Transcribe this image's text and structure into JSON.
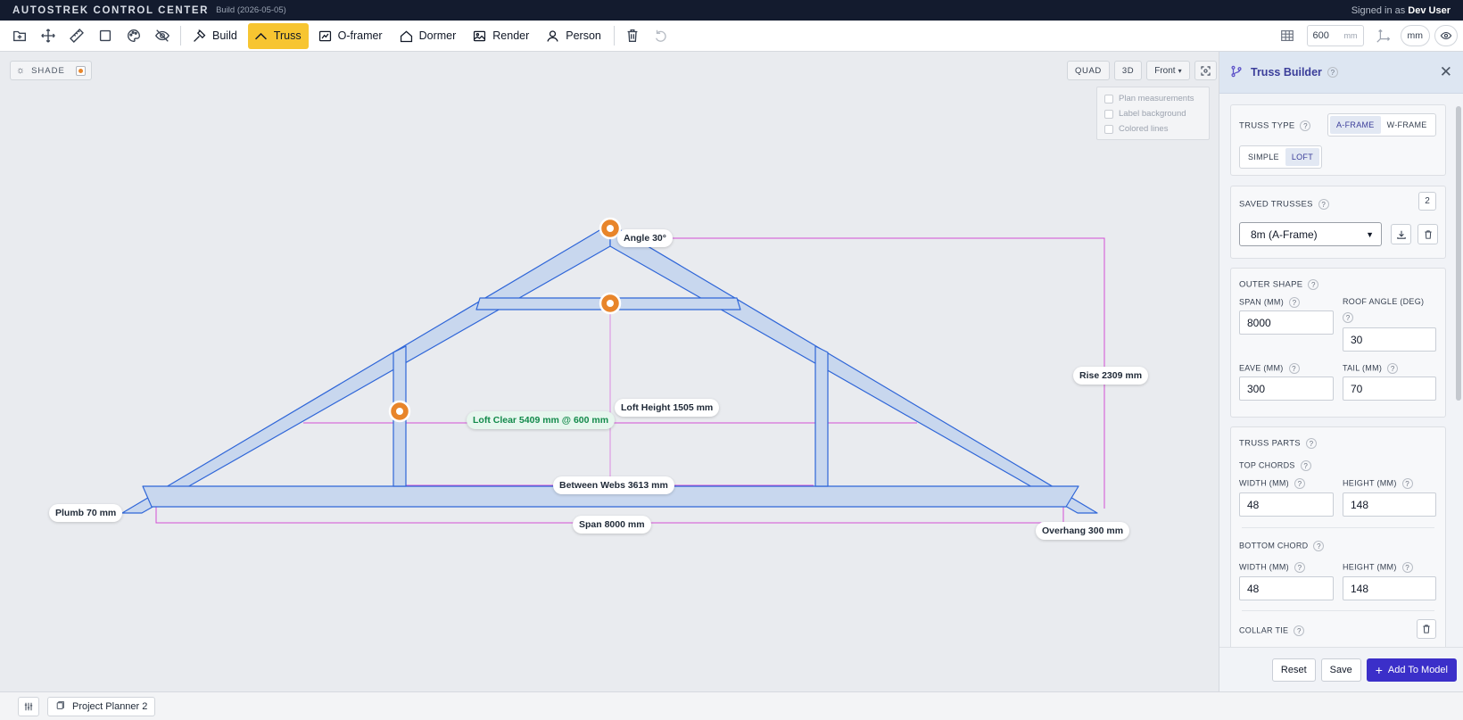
{
  "titlebar": {
    "app_name": "AUTOSTREK CONTROL CENTER",
    "build": "Build (2026-05-05)",
    "signed_in_prefix": "Signed in as",
    "user": "Dev User"
  },
  "toolbar": {
    "left_icons": [
      "new-project-icon",
      "move-icon",
      "ruler-icon",
      "square-icon",
      "palette-icon",
      "eye-off-icon"
    ],
    "buttons": [
      {
        "label": "Build",
        "icon": "hammer-icon",
        "active": false
      },
      {
        "label": "Truss",
        "icon": "truss-icon",
        "active": true
      },
      {
        "label": "O-framer",
        "icon": "frame-icon",
        "active": false
      },
      {
        "label": "Dormer",
        "icon": "house-icon",
        "active": false
      },
      {
        "label": "Render",
        "icon": "image-icon",
        "active": false
      },
      {
        "label": "Person",
        "icon": "person-icon",
        "active": false
      }
    ],
    "spacing_value": "600",
    "spacing_unit": "mm",
    "units_label": "mm"
  },
  "canvas": {
    "shade_label": "SHADE",
    "view_buttons": [
      "QUAD",
      "3D"
    ],
    "view_select": "Front",
    "overlay_options": [
      "Plan measurements",
      "Label background",
      "Colored lines"
    ],
    "labels": {
      "angle": "Angle 30°",
      "rise": "Rise 2309 mm",
      "loft_height": "Loft Height 1505 mm",
      "loft_clear": "Loft Clear 5409 mm @ 600 mm",
      "between_webs": "Between Webs 3613 mm",
      "span": "Span 8000 mm",
      "plumb": "Plumb 70 mm",
      "overhang": "Overhang 300 mm"
    },
    "colors": {
      "member_fill": "#c8d7ee",
      "member_stroke": "#2f66d8",
      "dimension": "#d24fd6",
      "handle": "#e8852a"
    }
  },
  "panel": {
    "title": "Truss Builder",
    "truss_type": {
      "label": "TRUSS TYPE",
      "frames": [
        "A-FRAME",
        "W-FRAME"
      ],
      "selected_frame": "A-FRAME",
      "styles": [
        "SIMPLE",
        "LOFT"
      ],
      "selected_style": "LOFT"
    },
    "saved_trusses": {
      "label": "SAVED TRUSSES",
      "count": "2",
      "selected": "8m (A-Frame)"
    },
    "outer_shape": {
      "label": "OUTER SHAPE",
      "span_label": "SPAN (MM)",
      "span": "8000",
      "roof_angle_label": "ROOF ANGLE (DEG)",
      "roof_angle": "30",
      "eave_label": "EAVE (MM)",
      "eave": "300",
      "tail_label": "TAIL (MM)",
      "tail": "70"
    },
    "truss_parts": {
      "label": "TRUSS PARTS",
      "top_chords_label": "TOP CHORDS",
      "bottom_chord_label": "BOTTOM CHORD",
      "width_label": "WIDTH (MM)",
      "height_label": "HEIGHT (MM)",
      "top_width": "48",
      "top_height": "148",
      "bottom_width": "48",
      "bottom_height": "148",
      "collar_tie_label": "COLLAR TIE"
    },
    "footer": {
      "reset": "Reset",
      "save": "Save",
      "add": "Add To Model"
    }
  },
  "bottombar": {
    "tab_label": "Project Planner 2"
  }
}
